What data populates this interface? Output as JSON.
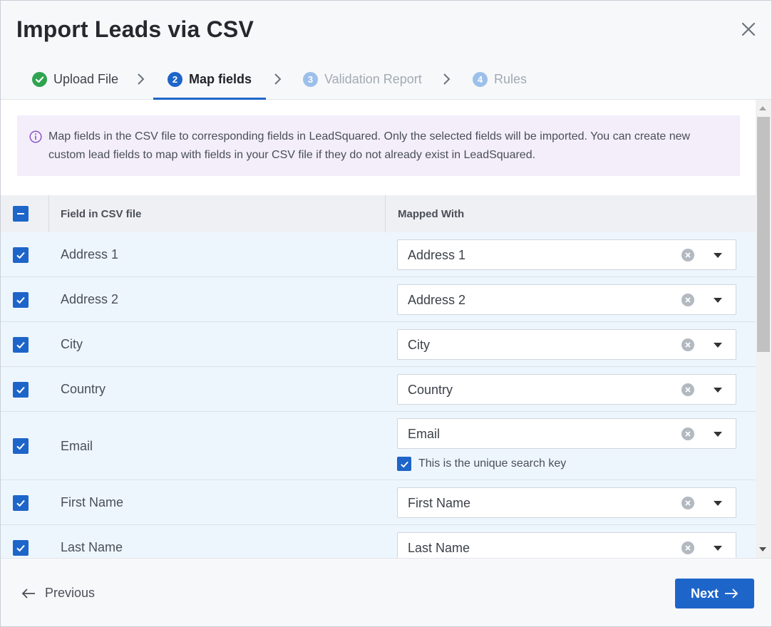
{
  "dialog": {
    "title": "Import Leads via CSV",
    "close_icon": "close-icon"
  },
  "steps": [
    {
      "number": "",
      "label": "Upload File",
      "state": "done",
      "icon": "check-circle-icon"
    },
    {
      "number": "2",
      "label": "Map fields",
      "state": "active"
    },
    {
      "number": "3",
      "label": "Validation Report",
      "state": "todo"
    },
    {
      "number": "4",
      "label": "Rules",
      "state": "todo"
    }
  ],
  "info": {
    "icon": "info-circle-icon",
    "text": "Map fields in the CSV file to corresponding fields in LeadSquared. Only the selected fields will be imported. You can create new custom lead fields to map with fields in your CSV file if they do not already exist in LeadSquared."
  },
  "table": {
    "select_all_state": "indeterminate",
    "headers": {
      "field": "Field in CSV file",
      "mapped": "Mapped With"
    },
    "rows": [
      {
        "field": "Address 1",
        "mapped": "Address 1",
        "checked": true
      },
      {
        "field": "Address 2",
        "mapped": "Address 2",
        "checked": true
      },
      {
        "field": "City",
        "mapped": "City",
        "checked": true
      },
      {
        "field": "Country",
        "mapped": "Country",
        "checked": true
      },
      {
        "field": "Email",
        "mapped": "Email",
        "checked": true,
        "unique_key_label": "This is the unique search key",
        "unique_key_checked": true
      },
      {
        "field": "First Name",
        "mapped": "First Name",
        "checked": true
      },
      {
        "field": "Last Name",
        "mapped": "Last Name",
        "checked": true
      }
    ]
  },
  "footer": {
    "previous_label": "Previous",
    "next_label": "Next"
  },
  "colors": {
    "primary": "#1e65c9",
    "info_bg": "#f3eefa",
    "row_bg": "#eef6fd",
    "success": "#2ea44f"
  }
}
